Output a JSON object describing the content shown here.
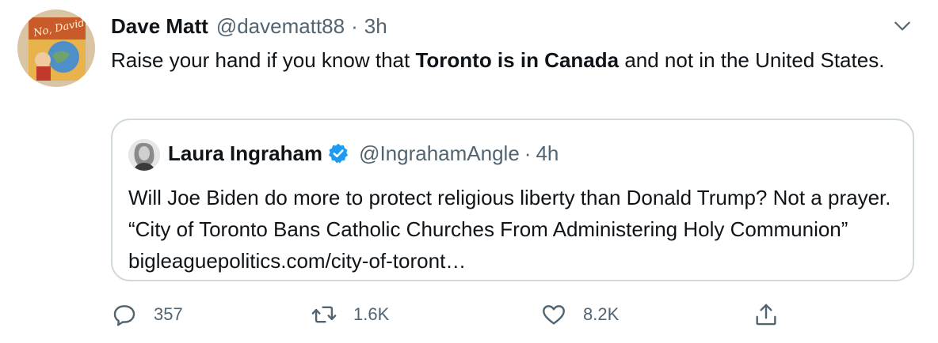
{
  "tweet": {
    "author_name": "Dave Matt",
    "author_handle": "@davematt88",
    "separator": "·",
    "time": "3h",
    "avatar_icon": "book-cover-avatar",
    "text_before": "Raise your hand if you know that ",
    "text_bold": "Toronto is in Canada",
    "text_after": " and not in the United States."
  },
  "quote": {
    "author_name": "Laura Ingraham",
    "verified_icon": "verified-badge-icon",
    "author_handle": "@IngrahamAngle",
    "separator": "·",
    "time": "4h",
    "text": "Will Joe Biden do more to protect religious liberty than Donald Trump? Not a prayer. “City of Toronto Bans Catholic Churches From Administering Holy Communion” bigleaguepolitics.com/city-of-toront…"
  },
  "actions": {
    "reply_count": "357",
    "retweet_count": "1.6K",
    "like_count": "8.2K"
  },
  "colors": {
    "text": "#0f1419",
    "secondary": "#536471",
    "border": "#cfd9de",
    "verified": "#1d9bf0"
  }
}
